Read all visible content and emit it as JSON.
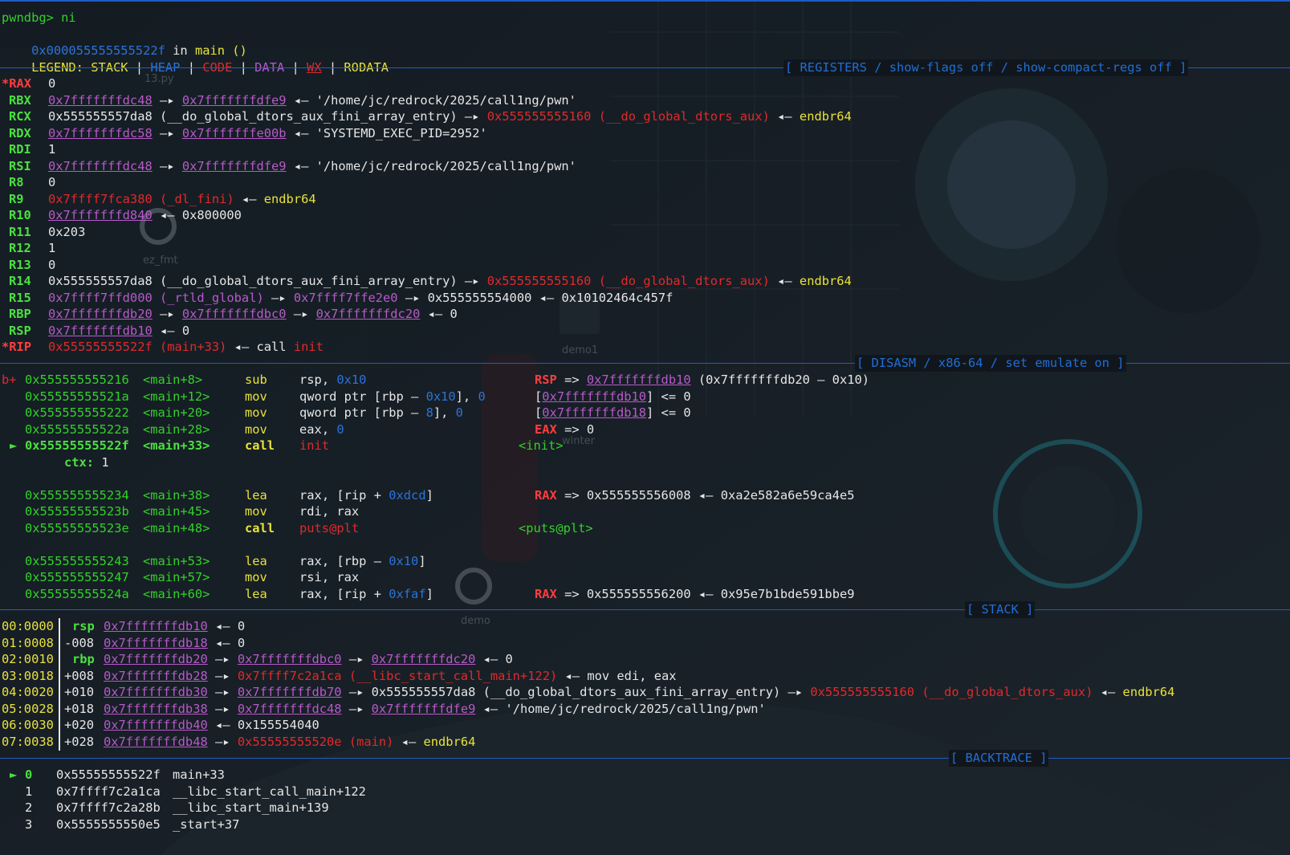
{
  "prompt": {
    "text": "pwndbg> ni"
  },
  "location": {
    "addr": "0x000055555555522f",
    "in": " in ",
    "func": "main ()"
  },
  "legend": {
    "label": "LEGEND: ",
    "stack": "STACK",
    "heap": "HEAP",
    "code": "CODE",
    "data": "DATA",
    "wx": "WX",
    "rodata": "RODATA",
    "sep": " | "
  },
  "sections": {
    "registers": "[ REGISTERS / show-flags off / show-compact-regs off ]",
    "disasm": "[ DISASM / x86-64 / set emulate on ]",
    "stack": "[ STACK ]",
    "backtrace": "[ BACKTRACE ]"
  },
  "registers": [
    {
      "name": "*RAX",
      "changed": true,
      "parts": [
        {
          "t": "0",
          "c": "white"
        }
      ]
    },
    {
      "name": "RBX",
      "parts": [
        {
          "t": "0x7fffffffdc48",
          "c": "purple",
          "u": true
        },
        {
          "t": " —▸ ",
          "c": "white"
        },
        {
          "t": "0x7fffffffdfe9",
          "c": "purple",
          "u": true
        },
        {
          "t": " ◂— ",
          "c": "white"
        },
        {
          "t": "'/home/jc/redrock/2025/call1ng/pwn'",
          "c": "white"
        }
      ]
    },
    {
      "name": "RCX",
      "parts": [
        {
          "t": "0x555555557da8",
          "c": "white"
        },
        {
          "t": " (__do_global_dtors_aux_fini_array_entry)",
          "c": "white"
        },
        {
          "t": " —▸ ",
          "c": "white"
        },
        {
          "t": "0x555555555160",
          "c": "red"
        },
        {
          "t": " (__do_global_dtors_aux)",
          "c": "red"
        },
        {
          "t": " ◂— ",
          "c": "white"
        },
        {
          "t": "endbr64",
          "c": "yellow"
        }
      ]
    },
    {
      "name": "RDX",
      "parts": [
        {
          "t": "0x7fffffffdc58",
          "c": "purple",
          "u": true
        },
        {
          "t": " —▸ ",
          "c": "white"
        },
        {
          "t": "0x7fffffffe00b",
          "c": "purple",
          "u": true
        },
        {
          "t": " ◂— ",
          "c": "white"
        },
        {
          "t": "'SYSTEMD_EXEC_PID=2952'",
          "c": "white"
        }
      ]
    },
    {
      "name": "RDI",
      "parts": [
        {
          "t": "1",
          "c": "white"
        }
      ]
    },
    {
      "name": "RSI",
      "parts": [
        {
          "t": "0x7fffffffdc48",
          "c": "purple",
          "u": true
        },
        {
          "t": " —▸ ",
          "c": "white"
        },
        {
          "t": "0x7fffffffdfe9",
          "c": "purple",
          "u": true
        },
        {
          "t": " ◂— ",
          "c": "white"
        },
        {
          "t": "'/home/jc/redrock/2025/call1ng/pwn'",
          "c": "white"
        }
      ]
    },
    {
      "name": "R8",
      "parts": [
        {
          "t": "0",
          "c": "white"
        }
      ]
    },
    {
      "name": "R9",
      "parts": [
        {
          "t": "0x7ffff7fca380",
          "c": "red"
        },
        {
          "t": " (_dl_fini)",
          "c": "red"
        },
        {
          "t": " ◂— ",
          "c": "white"
        },
        {
          "t": "endbr64",
          "c": "yellow"
        }
      ]
    },
    {
      "name": "R10",
      "parts": [
        {
          "t": "0x7fffffffd840",
          "c": "purple",
          "u": true
        },
        {
          "t": " ◂— ",
          "c": "white"
        },
        {
          "t": "0x800000",
          "c": "white"
        }
      ]
    },
    {
      "name": "R11",
      "parts": [
        {
          "t": "0x203",
          "c": "white"
        }
      ]
    },
    {
      "name": "R12",
      "parts": [
        {
          "t": "1",
          "c": "white"
        }
      ]
    },
    {
      "name": "R13",
      "parts": [
        {
          "t": "0",
          "c": "white"
        }
      ]
    },
    {
      "name": "R14",
      "parts": [
        {
          "t": "0x555555557da8",
          "c": "white"
        },
        {
          "t": " (__do_global_dtors_aux_fini_array_entry)",
          "c": "white"
        },
        {
          "t": " —▸ ",
          "c": "white"
        },
        {
          "t": "0x555555555160",
          "c": "red"
        },
        {
          "t": " (__do_global_dtors_aux)",
          "c": "red"
        },
        {
          "t": " ◂— ",
          "c": "white"
        },
        {
          "t": "endbr64",
          "c": "yellow"
        }
      ]
    },
    {
      "name": "R15",
      "parts": [
        {
          "t": "0x7ffff7ffd000",
          "c": "purple"
        },
        {
          "t": " (_rtld_global)",
          "c": "purple"
        },
        {
          "t": " —▸ ",
          "c": "white"
        },
        {
          "t": "0x7ffff7ffe2e0",
          "c": "purple"
        },
        {
          "t": " —▸ ",
          "c": "white"
        },
        {
          "t": "0x555555554000",
          "c": "white"
        },
        {
          "t": " ◂— ",
          "c": "white"
        },
        {
          "t": "0x10102464c457f",
          "c": "white"
        }
      ]
    },
    {
      "name": "RBP",
      "parts": [
        {
          "t": "0x7fffffffdb20",
          "c": "purple",
          "u": true
        },
        {
          "t": " —▸ ",
          "c": "white"
        },
        {
          "t": "0x7fffffffdbc0",
          "c": "purple",
          "u": true
        },
        {
          "t": " —▸ ",
          "c": "white"
        },
        {
          "t": "0x7fffffffdc20",
          "c": "purple",
          "u": true
        },
        {
          "t": " ◂— ",
          "c": "white"
        },
        {
          "t": "0",
          "c": "white"
        }
      ]
    },
    {
      "name": "RSP",
      "parts": [
        {
          "t": "0x7fffffffdb10",
          "c": "purple",
          "u": true
        },
        {
          "t": " ◂— ",
          "c": "white"
        },
        {
          "t": "0",
          "c": "white"
        }
      ]
    },
    {
      "name": "*RIP",
      "changed": true,
      "parts": [
        {
          "t": "0x55555555522f",
          "c": "red"
        },
        {
          "t": " (main+33)",
          "c": "red"
        },
        {
          "t": " ◂— ",
          "c": "white"
        },
        {
          "t": "call ",
          "c": "white"
        },
        {
          "t": "init",
          "c": "red"
        }
      ]
    }
  ],
  "disasm": [
    {
      "marker": "b+",
      "addr": "0x555555555216",
      "sym": "<main+8>",
      "mnem": "sub",
      "ops": [
        {
          "t": "rsp",
          "c": "white"
        },
        {
          "t": ", ",
          "c": "white"
        },
        {
          "t": "0x10",
          "c": "blue"
        }
      ],
      "note": [
        {
          "t": "RSP",
          "c": "bred"
        },
        {
          "t": " => ",
          "c": "white"
        },
        {
          "t": "0x7fffffffdb10",
          "c": "purple",
          "u": true
        },
        {
          "t": " (0x7fffffffdb20 – 0x10)",
          "c": "white"
        }
      ]
    },
    {
      "marker": "",
      "addr": "0x55555555521a",
      "sym": "<main+12>",
      "mnem": "mov",
      "ops": [
        {
          "t": "qword ptr [",
          "c": "white"
        },
        {
          "t": "rbp",
          "c": "white"
        },
        {
          "t": " – ",
          "c": "white"
        },
        {
          "t": "0x10",
          "c": "blue"
        },
        {
          "t": "], ",
          "c": "white"
        },
        {
          "t": "0",
          "c": "blue"
        }
      ],
      "note": [
        {
          "t": "[",
          "c": "white"
        },
        {
          "t": "0x7fffffffdb10",
          "c": "purple",
          "u": true
        },
        {
          "t": "] <= ",
          "c": "white"
        },
        {
          "t": "0",
          "c": "white"
        }
      ]
    },
    {
      "marker": "",
      "addr": "0x555555555222",
      "sym": "<main+20>",
      "mnem": "mov",
      "ops": [
        {
          "t": "qword ptr [",
          "c": "white"
        },
        {
          "t": "rbp",
          "c": "white"
        },
        {
          "t": " – ",
          "c": "white"
        },
        {
          "t": "8",
          "c": "blue"
        },
        {
          "t": "], ",
          "c": "white"
        },
        {
          "t": "0",
          "c": "blue"
        }
      ],
      "note": [
        {
          "t": "[",
          "c": "white"
        },
        {
          "t": "0x7fffffffdb18",
          "c": "purple",
          "u": true
        },
        {
          "t": "] <= ",
          "c": "white"
        },
        {
          "t": "0",
          "c": "white"
        }
      ]
    },
    {
      "marker": "",
      "addr": "0x55555555522a",
      "sym": "<main+28>",
      "mnem": "mov",
      "ops": [
        {
          "t": "eax",
          "c": "white"
        },
        {
          "t": ", ",
          "c": "white"
        },
        {
          "t": "0",
          "c": "blue"
        }
      ],
      "note": [
        {
          "t": "EAX",
          "c": "bred"
        },
        {
          "t": " => ",
          "c": "white"
        },
        {
          "t": "0",
          "c": "white"
        }
      ]
    },
    {
      "marker": "►",
      "current": true,
      "addr": "0x55555555522f",
      "sym": "<main+33>",
      "mnem": "call",
      "ops": [
        {
          "t": "init",
          "c": "red"
        }
      ],
      "note": [
        {
          "t": "<init>",
          "c": "green"
        }
      ]
    },
    {
      "ctx": true,
      "label": "ctx:",
      "value": " 1"
    },
    {
      "blank": true
    },
    {
      "marker": "",
      "addr": "0x555555555234",
      "sym": "<main+38>",
      "mnem": "lea",
      "ops": [
        {
          "t": "rax",
          "c": "white"
        },
        {
          "t": ", [",
          "c": "white"
        },
        {
          "t": "rip",
          "c": "white"
        },
        {
          "t": " + ",
          "c": "white"
        },
        {
          "t": "0xdcd",
          "c": "blue"
        },
        {
          "t": "]",
          "c": "white"
        }
      ],
      "note": [
        {
          "t": "RAX",
          "c": "bred"
        },
        {
          "t": " => ",
          "c": "white"
        },
        {
          "t": "0x555555556008",
          "c": "white"
        },
        {
          "t": " ◂— ",
          "c": "white"
        },
        {
          "t": "0xa2e582a6e59ca4e5",
          "c": "white"
        }
      ]
    },
    {
      "marker": "",
      "addr": "0x55555555523b",
      "sym": "<main+45>",
      "mnem": "mov",
      "ops": [
        {
          "t": "rdi",
          "c": "white"
        },
        {
          "t": ", ",
          "c": "white"
        },
        {
          "t": "rax",
          "c": "white"
        }
      ],
      "note": []
    },
    {
      "marker": "",
      "addr": "0x55555555523e",
      "sym": "<main+48>",
      "mnem": "call",
      "mnemBold": true,
      "ops": [
        {
          "t": "puts@plt",
          "c": "red"
        }
      ],
      "note": [
        {
          "t": "<puts@plt>",
          "c": "green"
        }
      ]
    },
    {
      "blank": true
    },
    {
      "marker": "",
      "addr": "0x555555555243",
      "sym": "<main+53>",
      "mnem": "lea",
      "ops": [
        {
          "t": "rax",
          "c": "white"
        },
        {
          "t": ", [",
          "c": "white"
        },
        {
          "t": "rbp",
          "c": "white"
        },
        {
          "t": " – ",
          "c": "white"
        },
        {
          "t": "0x10",
          "c": "blue"
        },
        {
          "t": "]",
          "c": "white"
        }
      ],
      "note": []
    },
    {
      "marker": "",
      "addr": "0x555555555247",
      "sym": "<main+57>",
      "mnem": "mov",
      "ops": [
        {
          "t": "rsi",
          "c": "white"
        },
        {
          "t": ", ",
          "c": "white"
        },
        {
          "t": "rax",
          "c": "white"
        }
      ],
      "note": []
    },
    {
      "marker": "",
      "addr": "0x55555555524a",
      "sym": "<main+60>",
      "mnem": "lea",
      "ops": [
        {
          "t": "rax",
          "c": "white"
        },
        {
          "t": ", [",
          "c": "white"
        },
        {
          "t": "rip",
          "c": "white"
        },
        {
          "t": " + ",
          "c": "white"
        },
        {
          "t": "0xfaf",
          "c": "blue"
        },
        {
          "t": "]",
          "c": "white"
        }
      ],
      "note": [
        {
          "t": "RAX",
          "c": "bred"
        },
        {
          "t": " => ",
          "c": "white"
        },
        {
          "t": "0x555555556200",
          "c": "white"
        },
        {
          "t": " ◂— ",
          "c": "white"
        },
        {
          "t": "0x95e7b1bde591bbe9",
          "c": "white"
        }
      ]
    }
  ],
  "stack": [
    {
      "idx": "00:0000",
      "reg": "rsp",
      "off": "",
      "parts": [
        {
          "t": "0x7fffffffdb10",
          "c": "purple",
          "u": true
        },
        {
          "t": " ◂— ",
          "c": "white"
        },
        {
          "t": "0",
          "c": "white"
        }
      ]
    },
    {
      "idx": "01:0008",
      "reg": "",
      "off": "-008",
      "parts": [
        {
          "t": "0x7fffffffdb18",
          "c": "purple",
          "u": true
        },
        {
          "t": " ◂— ",
          "c": "white"
        },
        {
          "t": "0",
          "c": "white"
        }
      ]
    },
    {
      "idx": "02:0010",
      "reg": "rbp",
      "off": "",
      "parts": [
        {
          "t": "0x7fffffffdb20",
          "c": "purple",
          "u": true
        },
        {
          "t": " —▸ ",
          "c": "white"
        },
        {
          "t": "0x7fffffffdbc0",
          "c": "purple",
          "u": true
        },
        {
          "t": " —▸ ",
          "c": "white"
        },
        {
          "t": "0x7fffffffdc20",
          "c": "purple",
          "u": true
        },
        {
          "t": " ◂— ",
          "c": "white"
        },
        {
          "t": "0",
          "c": "white"
        }
      ]
    },
    {
      "idx": "03:0018",
      "reg": "",
      "off": "+008",
      "parts": [
        {
          "t": "0x7fffffffdb28",
          "c": "purple",
          "u": true
        },
        {
          "t": " —▸ ",
          "c": "white"
        },
        {
          "t": "0x7ffff7c2a1ca",
          "c": "red"
        },
        {
          "t": " (__libc_start_call_main+122)",
          "c": "red"
        },
        {
          "t": " ◂— ",
          "c": "white"
        },
        {
          "t": "mov edi, eax",
          "c": "white"
        }
      ]
    },
    {
      "idx": "04:0020",
      "reg": "",
      "off": "+010",
      "parts": [
        {
          "t": "0x7fffffffdb30",
          "c": "purple",
          "u": true
        },
        {
          "t": " —▸ ",
          "c": "white"
        },
        {
          "t": "0x7fffffffdb70",
          "c": "purple",
          "u": true
        },
        {
          "t": " —▸ ",
          "c": "white"
        },
        {
          "t": "0x555555557da8",
          "c": "white"
        },
        {
          "t": " (__do_global_dtors_aux_fini_array_entry)",
          "c": "white"
        },
        {
          "t": " —▸ ",
          "c": "white"
        },
        {
          "t": "0x555555555160",
          "c": "red"
        },
        {
          "t": " (__do_global_dtors_aux)",
          "c": "red"
        },
        {
          "t": " ◂— ",
          "c": "white"
        },
        {
          "t": "endbr64",
          "c": "yellow"
        }
      ]
    },
    {
      "idx": "05:0028",
      "reg": "",
      "off": "+018",
      "parts": [
        {
          "t": "0x7fffffffdb38",
          "c": "purple",
          "u": true
        },
        {
          "t": " —▸ ",
          "c": "white"
        },
        {
          "t": "0x7fffffffdc48",
          "c": "purple",
          "u": true
        },
        {
          "t": " —▸ ",
          "c": "white"
        },
        {
          "t": "0x7fffffffdfe9",
          "c": "purple",
          "u": true
        },
        {
          "t": " ◂— ",
          "c": "white"
        },
        {
          "t": "'/home/jc/redrock/2025/call1ng/pwn'",
          "c": "white"
        }
      ]
    },
    {
      "idx": "06:0030",
      "reg": "",
      "off": "+020",
      "parts": [
        {
          "t": "0x7fffffffdb40",
          "c": "purple",
          "u": true
        },
        {
          "t": " ◂— ",
          "c": "white"
        },
        {
          "t": "0x155554040",
          "c": "white"
        }
      ]
    },
    {
      "idx": "07:0038",
      "reg": "",
      "off": "+028",
      "parts": [
        {
          "t": "0x7fffffffdb48",
          "c": "purple",
          "u": true
        },
        {
          "t": " —▸ ",
          "c": "white"
        },
        {
          "t": "0x55555555520e",
          "c": "red"
        },
        {
          "t": " (main)",
          "c": "red"
        },
        {
          "t": " ◂— ",
          "c": "white"
        },
        {
          "t": "endbr64",
          "c": "yellow"
        }
      ]
    }
  ],
  "backtrace": [
    {
      "marker": "►",
      "n": "0",
      "addr": "0x55555555522f",
      "sym": "main+33"
    },
    {
      "marker": "",
      "n": "1",
      "addr": "0x7ffff7c2a1ca",
      "sym": "__libc_start_call_main+122"
    },
    {
      "marker": "",
      "n": "2",
      "addr": "0x7ffff7c2a28b",
      "sym": "__libc_start_main+139"
    },
    {
      "marker": "",
      "n": "3",
      "addr": "0x5555555550e5",
      "sym": "_start+37"
    }
  ],
  "desktop_labels": [
    "13.py",
    "ez_fmt",
    "demo1",
    "winter",
    "demo"
  ],
  "colors": {
    "background": "#11161c",
    "separator": "#1f5cc4",
    "green": "#33d12a",
    "red": "#e02a2a",
    "yellow": "#e8e23a",
    "blue": "#2b73d9",
    "purple": "#b65ac9"
  }
}
